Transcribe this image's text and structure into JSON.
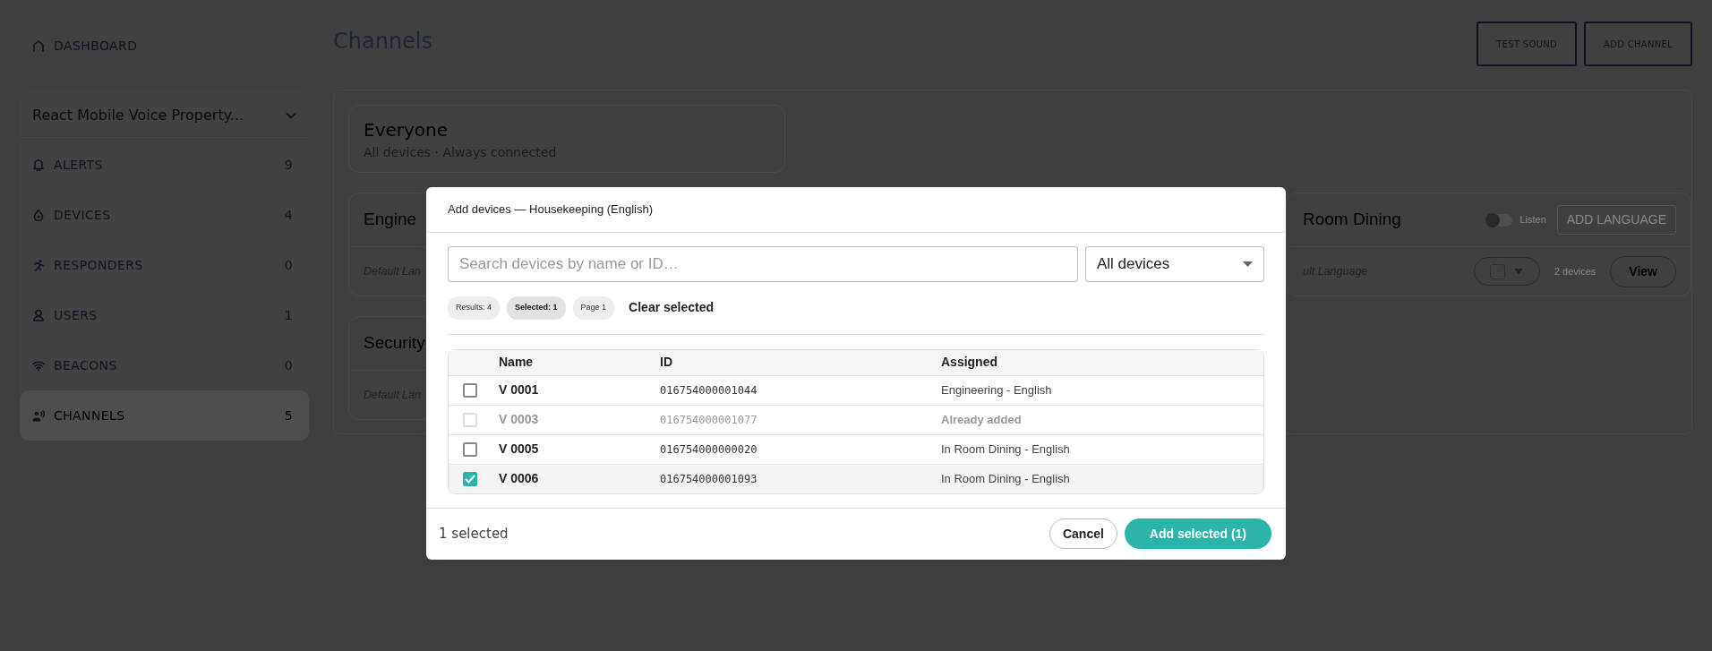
{
  "sidebar": {
    "top_item": {
      "label": "DASHBOARD"
    },
    "property_selector": {
      "value": "React Mobile Voice Property..."
    },
    "items": [
      {
        "label": "ALERTS",
        "count": "9",
        "selected": false
      },
      {
        "label": "DEVICES",
        "count": "4",
        "selected": false
      },
      {
        "label": "RESPONDERS",
        "count": "0",
        "selected": false
      },
      {
        "label": "USERS",
        "count": "1",
        "selected": false
      },
      {
        "label": "BEACONS",
        "count": "0",
        "selected": false
      },
      {
        "label": "CHANNELS",
        "count": "5",
        "selected": true
      }
    ]
  },
  "header": {
    "title": "Channels",
    "buttons": [
      "TEST SOUND",
      "ADD CHANNEL"
    ]
  },
  "everyone_card": {
    "title": "Everyone",
    "subtitle": "All devices · Always connected"
  },
  "channel_cards": [
    {
      "title": "Engine",
      "language": "Default Lan"
    },
    {
      "title": "Room Dining",
      "language": "ult Language",
      "listen": {
        "label": "Listen",
        "on": false
      },
      "add_language": "ADD LANGUAGE",
      "devices": "2 devices",
      "view": "View"
    },
    {
      "title": "Security",
      "language": "Default Lan"
    }
  ],
  "modal": {
    "title": "Add devices — Housekeeping (English)",
    "search": {
      "placeholder": "Search devices by name or ID…"
    },
    "filter": {
      "value": "All devices"
    },
    "chips": [
      {
        "label": "Results: 4",
        "emphasis": false
      },
      {
        "label": "Selected: 1",
        "emphasis": true
      },
      {
        "label": "Page 1",
        "emphasis": false
      }
    ],
    "clear_link": "Clear selected",
    "table": {
      "columns": [
        "Name",
        "ID",
        "Assigned"
      ],
      "rows": [
        {
          "name": "V 0001",
          "id": "016754000001044",
          "assigned": "Engineering - English",
          "checked": false,
          "disabled": false
        },
        {
          "name": "V 0003",
          "id": "016754000001077",
          "assigned": "Already added",
          "checked": false,
          "disabled": true
        },
        {
          "name": "V 0005",
          "id": "016754000000020",
          "assigned": "In Room Dining - English",
          "checked": false,
          "disabled": false
        },
        {
          "name": "V 0006",
          "id": "016754000001093",
          "assigned": "In Room Dining - English",
          "checked": true,
          "disabled": false
        }
      ]
    },
    "footer_status": "1 selected",
    "cancel": "Cancel",
    "submit": "Add selected (1)"
  }
}
